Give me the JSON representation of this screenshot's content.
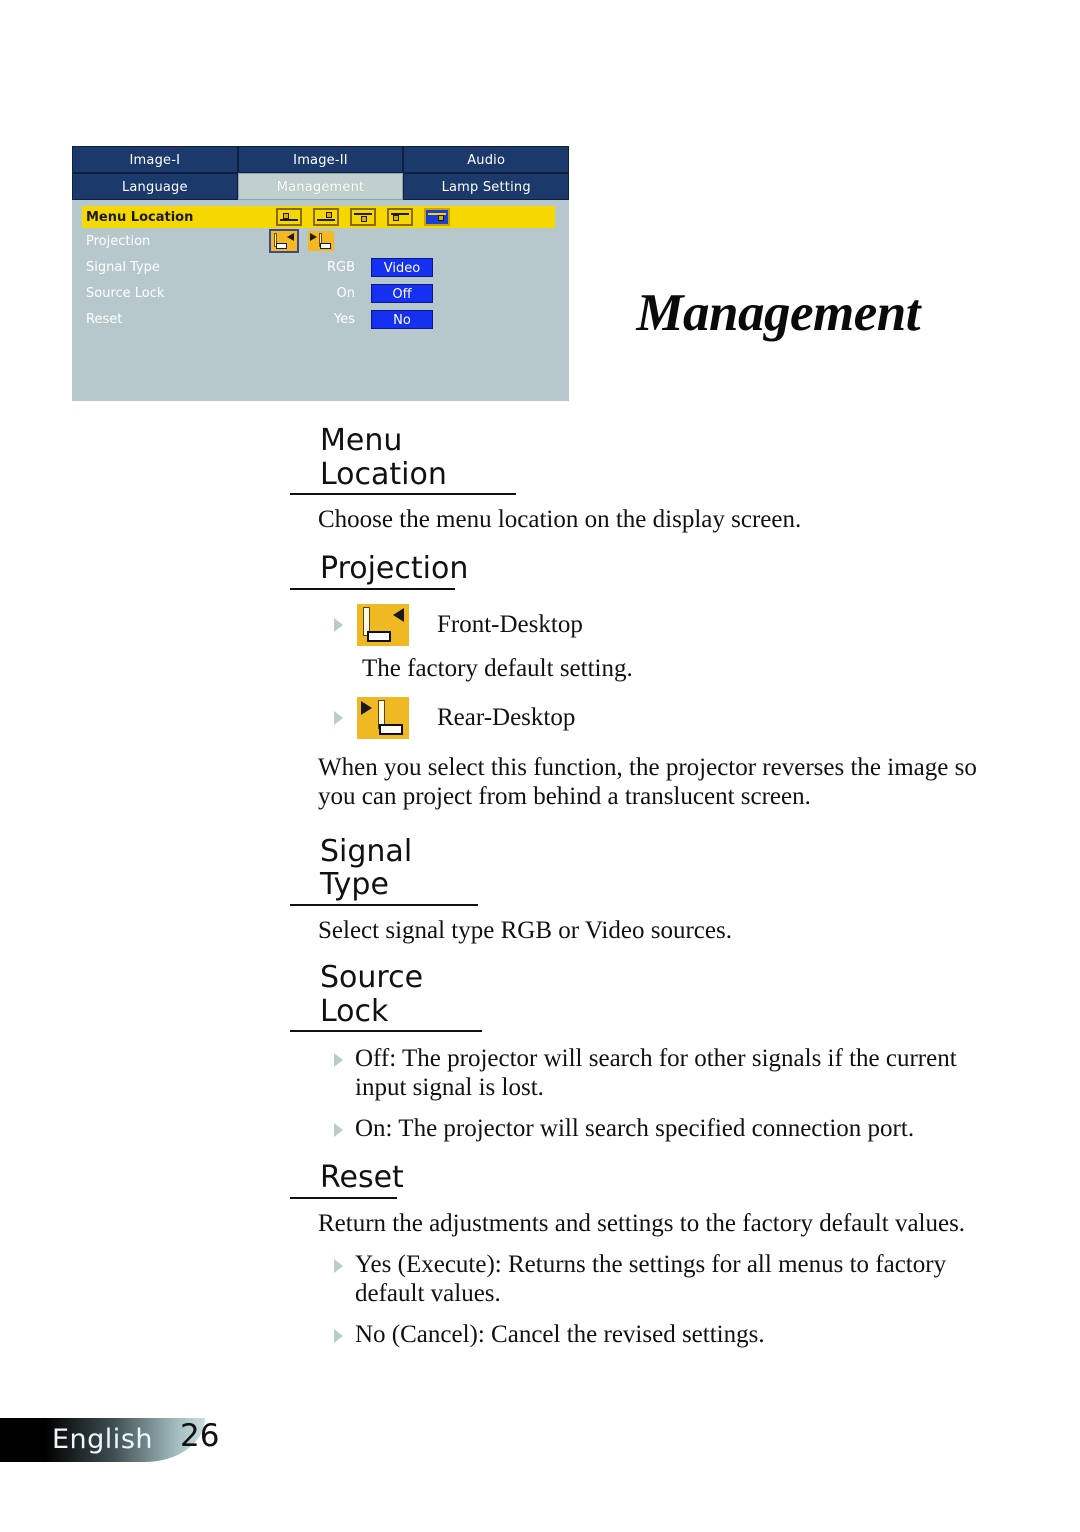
{
  "page": {
    "title": "Management",
    "footer_language": "English",
    "footer_page_number": "26"
  },
  "osd": {
    "tabs_row1": [
      {
        "label": "Image-I",
        "active": false
      },
      {
        "label": "Image-II",
        "active": false
      },
      {
        "label": "Audio",
        "active": false
      }
    ],
    "tabs_row2": [
      {
        "label": "Language",
        "active": false
      },
      {
        "label": "Management",
        "active": true
      },
      {
        "label": "Lamp Setting",
        "active": false
      }
    ],
    "rows": [
      {
        "label": "Menu Location",
        "highlighted": true,
        "type": "icons"
      },
      {
        "label": "Projection",
        "highlighted": false,
        "type": "proj-icons"
      },
      {
        "label": "Signal Type",
        "highlighted": false,
        "type": "options",
        "option_unselected": "RGB",
        "option_selected": "Video"
      },
      {
        "label": "Source Lock",
        "highlighted": false,
        "type": "options",
        "option_unselected": "On",
        "option_selected": "Off"
      },
      {
        "label": "Reset",
        "highlighted": false,
        "type": "options",
        "option_unselected": "Yes",
        "option_selected": "No"
      }
    ],
    "colors": {
      "tab_background": "#1b3a6b",
      "tab_active_background": "#bfd0ce",
      "panel_background": "#b6c8cc",
      "row_highlight": "#f5d800",
      "selected_button": "#1530f0"
    }
  },
  "sections": [
    {
      "heading": "Menu Location",
      "body": "Choose the menu location on the display screen."
    },
    {
      "heading": "Projection",
      "item1_label": "Front-Desktop",
      "item1_body": "The factory default setting.",
      "item2_label": "Rear-Desktop",
      "item2_body": "When you select this function, the projector reverses the image so you can project from behind a translucent screen."
    },
    {
      "heading": "Signal Type",
      "body": "Select signal type RGB or Video sources."
    },
    {
      "heading": "Source Lock",
      "bullet1": "Off: The projector will search for other signals if the current input signal is lost.",
      "bullet2": "On: The projector will search specified connection port."
    },
    {
      "heading": "Reset",
      "body": "Return the adjustments and settings to the factory default values.",
      "bullet1": "Yes (Execute): Returns the settings for all menus to factory default values.",
      "bullet2": "No (Cancel): Cancel the revised settings."
    }
  ]
}
